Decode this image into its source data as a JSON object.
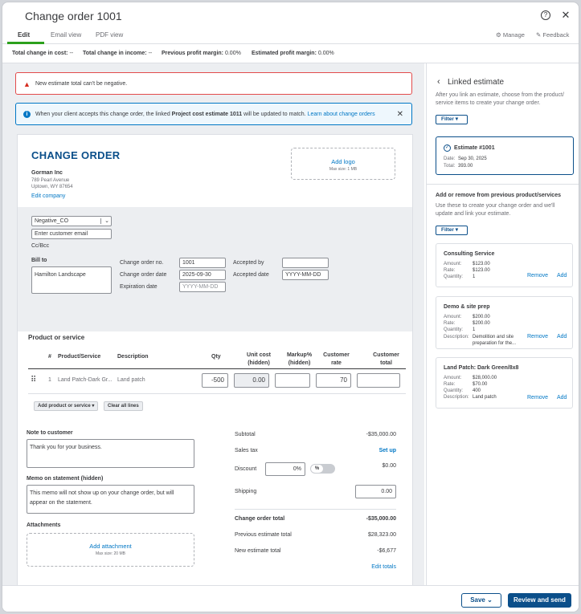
{
  "header": {
    "title": "Change order 1001",
    "tabs": [
      {
        "label": "Edit"
      },
      {
        "label": "Email view"
      },
      {
        "label": "PDF view"
      }
    ],
    "manage_label": "Manage",
    "feedback_label": "Feedback",
    "help_icon": "help-icon",
    "close_icon": "close-icon"
  },
  "summary": {
    "total_change_cost_label": "Total change in cost:",
    "total_change_cost_value": "--",
    "total_change_income_label": "Total change in income:",
    "total_change_income_value": "--",
    "prev_margin_label": "Previous profit margin:",
    "prev_margin_value": "0.00%",
    "est_margin_label": "Estimated profit margin:",
    "est_margin_value": "0.00%"
  },
  "alerts": {
    "error_text": "New estimate total can't be negative.",
    "info_prefix": "When your client accepts this change order, the linked ",
    "info_bold": "Project cost estimate 1011",
    "info_suffix": " will be updated to match.",
    "info_link": "Learn about change orders"
  },
  "doc": {
    "heading": "CHANGE ORDER",
    "company_name": "Gorman Inc",
    "address_line1": "789 Pearl Avenue",
    "address_line2": "Uptown, WY 87654",
    "edit_company": "Edit company",
    "add_logo": "Add logo",
    "logo_max": "Max size: 1 MB",
    "customer_select": "Negative_CO",
    "email_placeholder": "Enter customer email",
    "cc_bcc": "Cc/Bcc",
    "bill_to_label": "Bill to",
    "bill_to_value": "Hamilton Landscape",
    "change_order_no_label": "Change order no.",
    "change_order_no": "1001",
    "change_order_date_label": "Change order date",
    "change_order_date": "2025-09-30",
    "expiration_date_label": "Expiration date",
    "expiration_placeholder": "YYYY-MM-DD",
    "accepted_by_label": "Accepted by",
    "accepted_date_label": "Accepted date",
    "accepted_date_placeholder": "YYYY-MM-DD"
  },
  "lines": {
    "section_title": "Product or service",
    "columns": [
      "#",
      "Product/Service",
      "Description",
      "Qty",
      "Unit cost (hidden)",
      "Markup% (hidden)",
      "Customer rate",
      "Customer total"
    ],
    "col_unit_cost_1": "Unit cost",
    "col_unit_cost_2": "(hidden)",
    "col_markup_1": "Markup%",
    "col_markup_2": "(hidden)",
    "col_rate_1": "Customer",
    "col_rate_2": "rate",
    "col_total_1": "Customer",
    "col_total_2": "total",
    "rows": [
      {
        "num": "1",
        "product": "Land Patch-Dark Gr...",
        "description": "Land patch",
        "qty": "-500",
        "unit_cost": "0.00",
        "markup": "",
        "rate": "70",
        "total": ""
      }
    ],
    "add_product_label": "Add product or service",
    "clear_lines_label": "Clear all lines"
  },
  "notes": {
    "note_label": "Note to customer",
    "note_value": "Thank you for your business.",
    "memo_label": "Memo on statement (hidden)",
    "memo_value": "This memo will not show up on your change order, but will appear on the statement.",
    "attachments_label": "Attachments",
    "add_attachment": "Add attachment",
    "attach_max": "Max size: 20 MB"
  },
  "totals": {
    "subtotal_label": "Subtotal",
    "subtotal_value": "-$35,000.00",
    "sales_tax_label": "Sales tax",
    "sales_tax_action": "Set up",
    "discount_label": "Discount",
    "discount_input": "0%",
    "discount_toggle": "%",
    "discount_value": "$0.00",
    "shipping_label": "Shipping",
    "shipping_value": "0.00",
    "change_order_total_label": "Change order total",
    "change_order_total_value": "-$35,000.00",
    "prev_estimate_total_label": "Previous estimate total",
    "prev_estimate_total_value": "$28,323.00",
    "new_estimate_total_label": "New estimate total",
    "new_estimate_total_value": "-$6,677",
    "edit_totals": "Edit totals"
  },
  "panel": {
    "title": "Linked estimate",
    "desc": "After you link an estimate, choose from the product/ service items to create your change order.",
    "filter_label": "Filter",
    "estimate": {
      "title": "Estimate #1001",
      "date_label": "Date:",
      "date": "Sep 30, 2025",
      "total_label": "Total:",
      "total": "393.00"
    },
    "section_title": "Add or remove from previous product/services",
    "section_desc": "Use these to create your change order and we'll update and link your estimate.",
    "filter2_label": "Filter",
    "remove_label": "Remove",
    "add_label": "Add",
    "items": [
      {
        "name": "Consulting Service",
        "amount": "$123.00",
        "rate": "$123.00",
        "quantity": "1",
        "description": ""
      },
      {
        "name": "Demo & site prep",
        "amount": "$200.00",
        "rate": "$200.00",
        "quantity": "1",
        "description": "Demolition and site preparation for the..."
      },
      {
        "name": "Land Patch: Dark Green/8x8",
        "amount": "$28,000.00",
        "rate": "$70.00",
        "quantity": "400",
        "description": "Land patch"
      }
    ],
    "amount_label": "Amount:",
    "rate_label": "Rate:",
    "quantity_label": "Quantity:",
    "description_label": "Description:"
  },
  "footer": {
    "save_label": "Save",
    "review_send_label": "Review and send"
  },
  "colors": {
    "brand_dark": "#0b4f8a",
    "link": "#0077c5",
    "error": "#d52b1e"
  }
}
